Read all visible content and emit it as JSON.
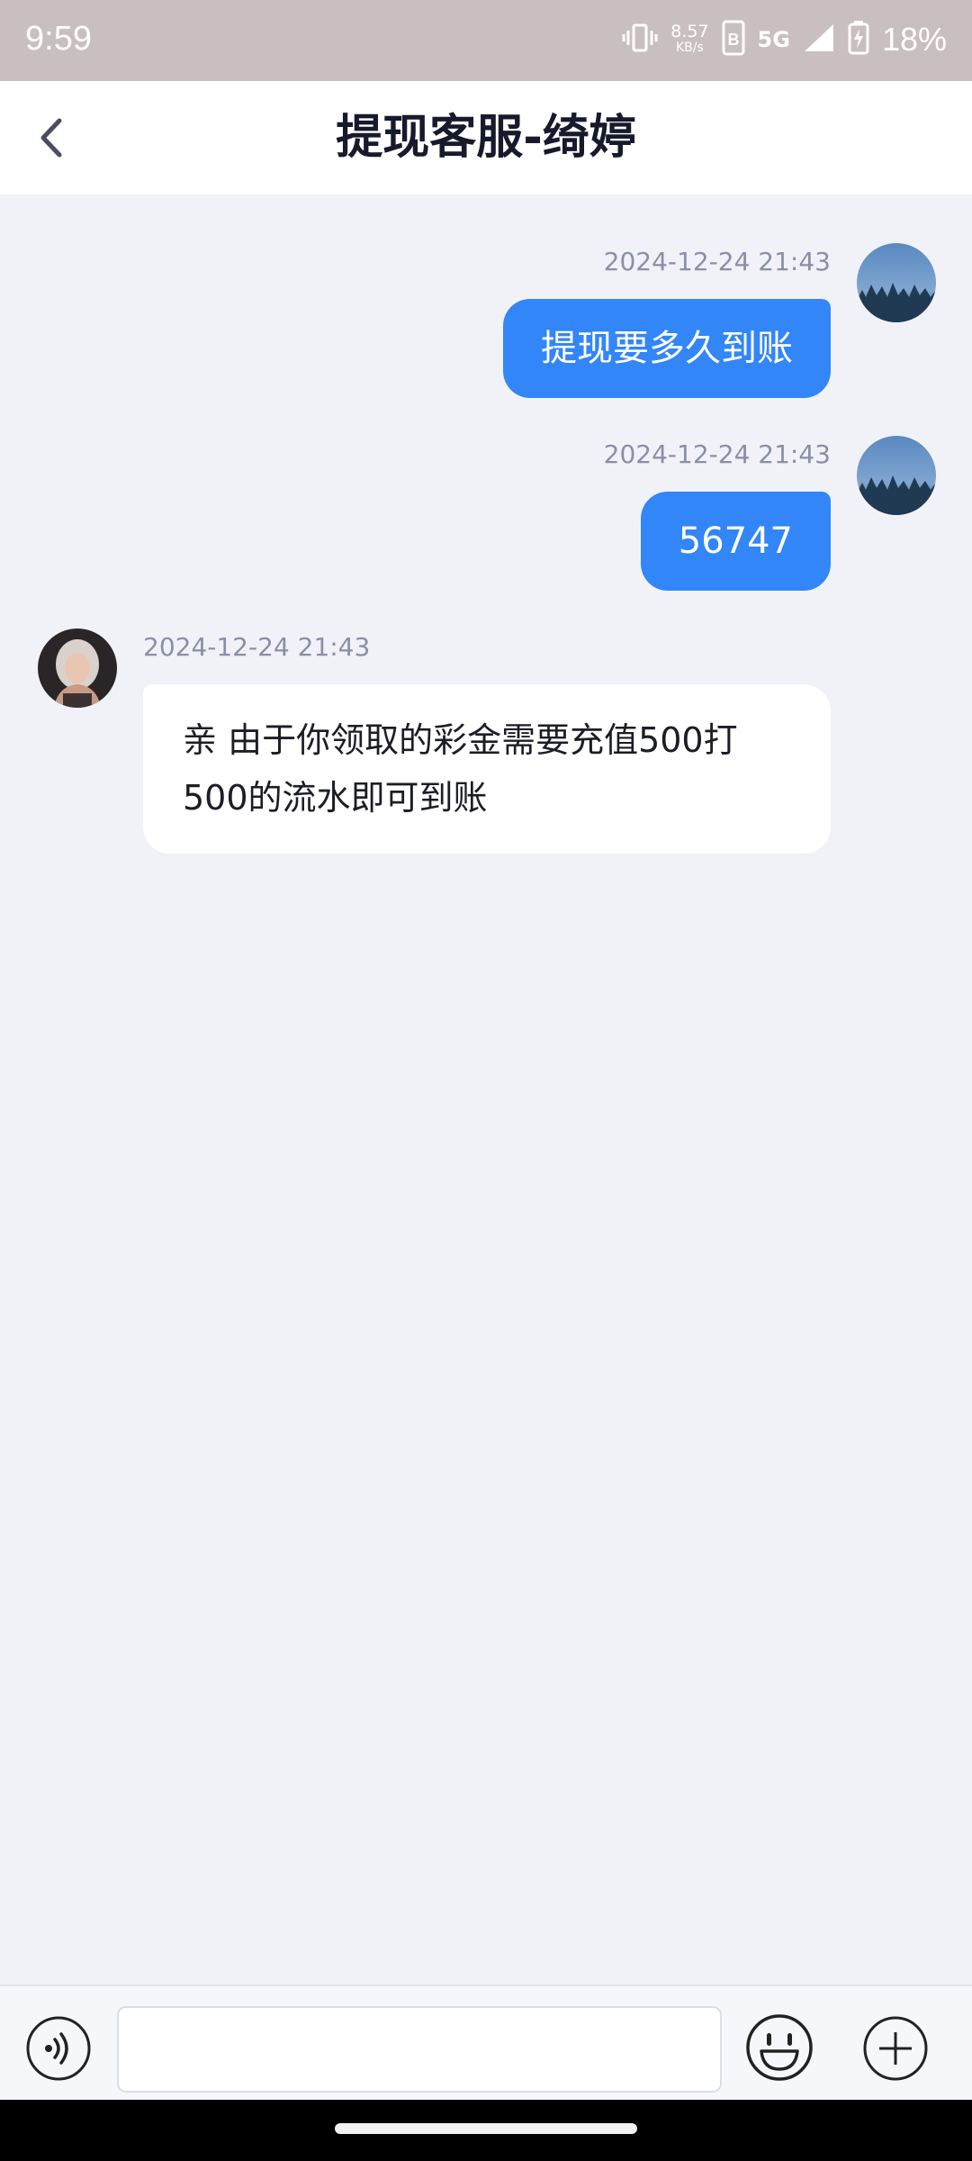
{
  "status_bar": {
    "time": "9:59",
    "net_speed_value": "8.57",
    "net_speed_unit": "KB/s",
    "network_type": "5G",
    "battery_percent": "18%",
    "icons": [
      "vibrate-icon",
      "sim-icon",
      "signal-icon",
      "battery-charging-icon"
    ]
  },
  "header": {
    "title": "提现客服-绮婷",
    "back_icon": "chevron-left-icon"
  },
  "messages": [
    {
      "direction": "outgoing",
      "timestamp": "2024-12-24 21:43",
      "text": "提现要多久到账"
    },
    {
      "direction": "outgoing",
      "timestamp": "2024-12-24 21:43",
      "text": "56747"
    },
    {
      "direction": "incoming",
      "timestamp": "2024-12-24 21:43",
      "text": "亲 由于你领取的彩金需要充值500打500的流水即可到账"
    }
  ],
  "input_bar": {
    "message_value": "",
    "placeholder": "",
    "icons": [
      "voice-icon",
      "emoji-icon",
      "plus-icon"
    ]
  },
  "colors": {
    "accent": "#3286f7",
    "background": "#f1f2f8",
    "status_bar": "#c9bfc1"
  }
}
